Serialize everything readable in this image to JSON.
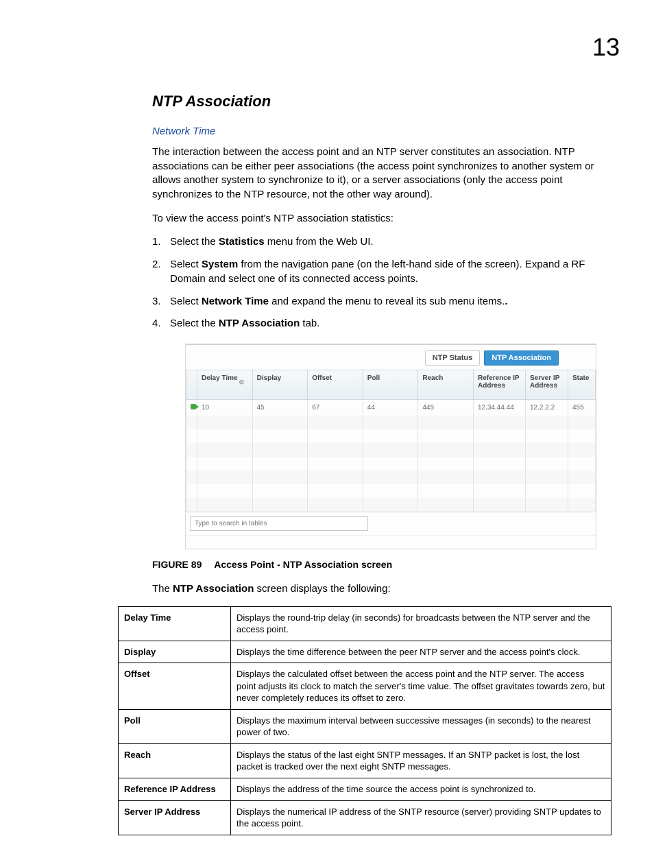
{
  "page_number": "13",
  "section_title": "NTP Association",
  "breadcrumb_link": "Network Time",
  "intro_para": "The interaction between the access point and an NTP server constitutes an association. NTP associations can be either peer associations (the access point synchronizes to another system or allows another system to synchronize to it), or a server associations (only the access point synchronizes to the NTP resource, not the other way around).",
  "lead_in": "To view the access point's NTP association statistics:",
  "steps": [
    {
      "pre": "Select the ",
      "bold": "Statistics",
      "post": " menu from the Web UI."
    },
    {
      "pre": "Select ",
      "bold": "System",
      "post": " from the navigation pane (on the left-hand side of the screen). Expand a RF Domain and select one of its connected access points."
    },
    {
      "pre": "Select ",
      "bold": "Network Time",
      "post": " and expand the menu to reveal its sub menu items."
    },
    {
      "pre": "Select the ",
      "bold": "NTP Association",
      "post": " tab."
    }
  ],
  "screenshot": {
    "tabs": [
      {
        "label": "NTP Status",
        "active": false
      },
      {
        "label": "NTP Association",
        "active": true
      }
    ],
    "columns": [
      "Delay Time",
      "Display",
      "Offset",
      "Poll",
      "Reach",
      "Reference IP Address",
      "Server IP Address",
      "State"
    ],
    "rows": [
      {
        "values": [
          "10",
          "45",
          "67",
          "44",
          "445",
          "12.34.44.44",
          "12.2.2.2",
          "455"
        ]
      }
    ],
    "search_placeholder": "Type to search in tables"
  },
  "figure": {
    "label": "FIGURE 89",
    "caption": "Access Point - NTP Association screen"
  },
  "after_fig": {
    "pre": "The ",
    "bold": "NTP Association",
    "post": " screen displays the following:"
  },
  "definitions": [
    {
      "term": "Delay Time",
      "desc": "Displays the round-trip delay (in seconds) for broadcasts between the NTP server and the access point."
    },
    {
      "term": "Display",
      "desc": "Displays the time difference between the peer NTP server and the access point's clock."
    },
    {
      "term": "Offset",
      "desc": "Displays the calculated offset between the access point and the NTP server. The access point adjusts its clock to match the server's time value. The offset gravitates towards zero, but never completely reduces its offset to zero."
    },
    {
      "term": "Poll",
      "desc": "Displays the maximum interval between successive messages (in seconds) to the nearest power of two."
    },
    {
      "term": "Reach",
      "desc": "Displays the status of the last eight SNTP messages. If an SNTP packet is lost, the lost packet is tracked over the next eight SNTP messages."
    },
    {
      "term": "Reference IP Address",
      "desc": "Displays the address of the time source the access point is synchronized to."
    },
    {
      "term": "Server IP Address",
      "desc": "Displays the numerical IP address of the SNTP resource (server) providing SNTP updates to the access point."
    }
  ]
}
